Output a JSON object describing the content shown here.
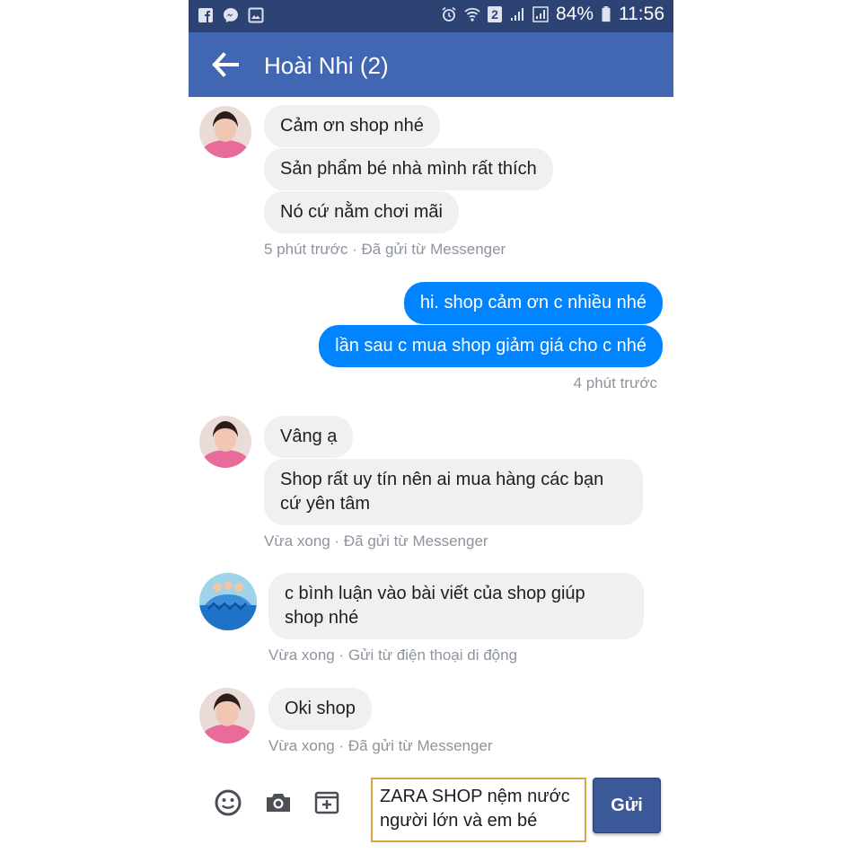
{
  "status_bar": {
    "battery": "84%",
    "time": "11:56",
    "sim_badge": "2"
  },
  "header": {
    "title": "Hoài Nhi (2)"
  },
  "messages": [
    {
      "text": "Cảm ơn shop nhé",
      "direction": "in"
    },
    {
      "text": "Sản phẩm bé nhà mình rất thích",
      "direction": "in"
    },
    {
      "text": "Nó cứ nằm chơi mãi",
      "direction": "in"
    },
    {
      "text": "hi. shop cảm ơn c nhiều nhé",
      "direction": "out"
    },
    {
      "text": "lần sau c mua shop giảm giá cho c nhé",
      "direction": "out"
    },
    {
      "text": "Vâng ạ",
      "direction": "in"
    },
    {
      "text": "Shop rất uy tín nên ai mua hàng các bạn cứ yên tâm",
      "direction": "in"
    },
    {
      "text": "c bình luận vào bài viết của shop giúp shop nhé",
      "direction": "in"
    },
    {
      "text": "Oki shop",
      "direction": "in"
    }
  ],
  "meta": [
    "5 phút trước · Đã gửi từ Messenger",
    "4 phút trước",
    "Vừa xong · Đã gửi từ Messenger",
    "Vừa xong · Gửi từ điện thoại di động",
    "Vừa xong · Đã gửi từ Messenger"
  ],
  "composer": {
    "input_value": "ZARA SHOP nệm nước người lớn và em bé",
    "send_label": "Gửi"
  },
  "colors": {
    "status_bar": "#2d4373",
    "app_bar": "#4267b2",
    "outgoing_bubble": "#0084ff",
    "incoming_bubble": "#f1f0f0",
    "send_button": "#3b5998"
  },
  "icons": [
    "facebook-icon",
    "messenger-icon",
    "image-icon",
    "alarm-icon",
    "wifi-icon",
    "signal-icon",
    "battery-icon",
    "back-arrow-icon",
    "emoji-icon",
    "camera-icon",
    "add-attachment-icon"
  ]
}
